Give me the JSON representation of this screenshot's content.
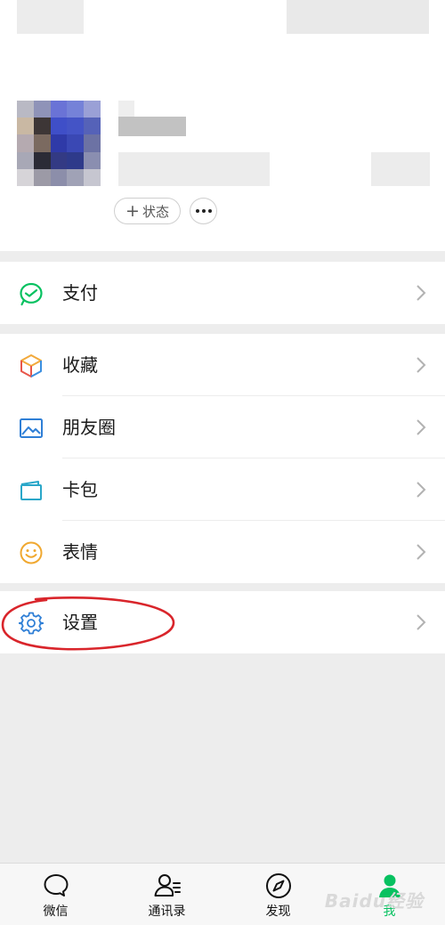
{
  "profile": {
    "status_label": "状态",
    "status_plus": "+"
  },
  "menu": {
    "pay": "支付",
    "favorites": "收藏",
    "moments": "朋友圈",
    "cards": "卡包",
    "stickers": "表情",
    "settings": "设置"
  },
  "tabbar": {
    "chats": "微信",
    "contacts": "通讯录",
    "discover": "发现",
    "me": "我"
  },
  "colors": {
    "accent_green": "#07c160",
    "annotation_red": "#d9252b"
  },
  "watermark": "Baidu经验"
}
